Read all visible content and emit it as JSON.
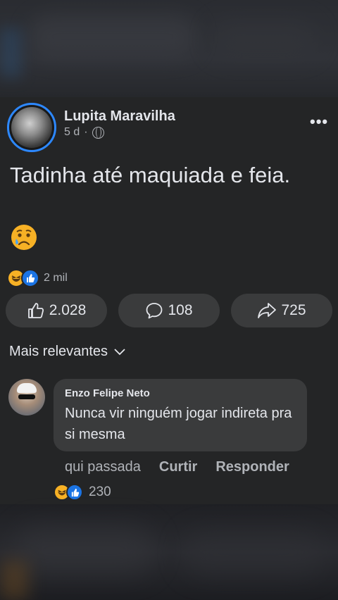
{
  "post": {
    "author": "Lupita Maravilha",
    "time": "5 d",
    "separator": "·",
    "more": "•••",
    "text": "Tadinha até maquiada e feia.",
    "emoji": "sad-tear-face",
    "reaction_count": "2 mil",
    "actions": {
      "like_count": "2.028",
      "comment_count": "108",
      "share_count": "725"
    }
  },
  "comments_sort": {
    "label": "Mais relevantes"
  },
  "comment": {
    "author": "Enzo Felipe Neto",
    "text": "Nunca vir ninguém jogar indireta pra si mesma",
    "time": "qui passada",
    "like_label": "Curtir",
    "reply_label": "Responder",
    "reaction_count": "230"
  },
  "colors": {
    "background": "#242526",
    "accent": "#1b74e4",
    "pill": "#3a3b3c",
    "secondary_text": "#b0b3b8"
  }
}
